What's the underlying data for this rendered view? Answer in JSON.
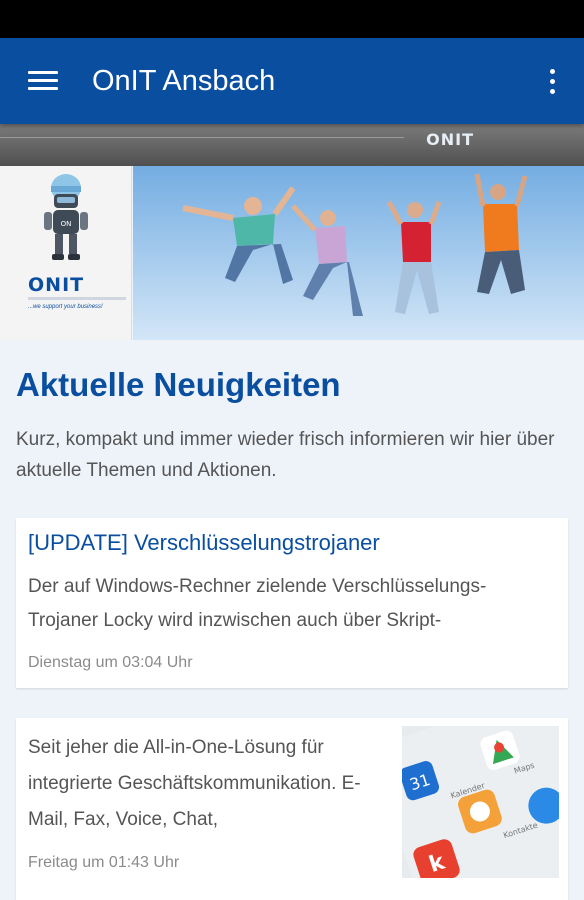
{
  "app_bar": {
    "title": "OnIT Ansbach",
    "menu_icon": "hamburger-menu-icon",
    "overflow_icon": "more-vert-icon"
  },
  "banner": {
    "strip_logo": "ONIT",
    "left_logo_text_on": "ON",
    "left_logo_text_it": "IT",
    "left_logo_tagline": "...we support your business!"
  },
  "news": {
    "heading": "Aktuelle Neuigkeiten",
    "intro": "Kurz, kompakt und immer wieder frisch informieren wir hier über aktuelle Themen und Aktionen.",
    "items": [
      {
        "title": "[UPDATE] Verschlüsselungstrojaner",
        "text": "Der auf Windows-Rechner zielende Verschlüsselungs-Trojaner Locky wird inzwischen auch über Skript-",
        "date": "Dienstag um 03:04 Uhr"
      },
      {
        "text": "Seit jeher die All-in-One-Lösung für integrierte Geschäftskommunikation. E-Mail, Fax, Voice, Chat,",
        "date": "Freitag um 01:43 Uhr",
        "thumb_labels": [
          "Kalender",
          "Kontakte",
          "Maps"
        ]
      }
    ]
  },
  "colors": {
    "primary": "#0a4ea0",
    "background": "#eef3fa",
    "text": "#555555",
    "meta": "#8b8b8b"
  }
}
